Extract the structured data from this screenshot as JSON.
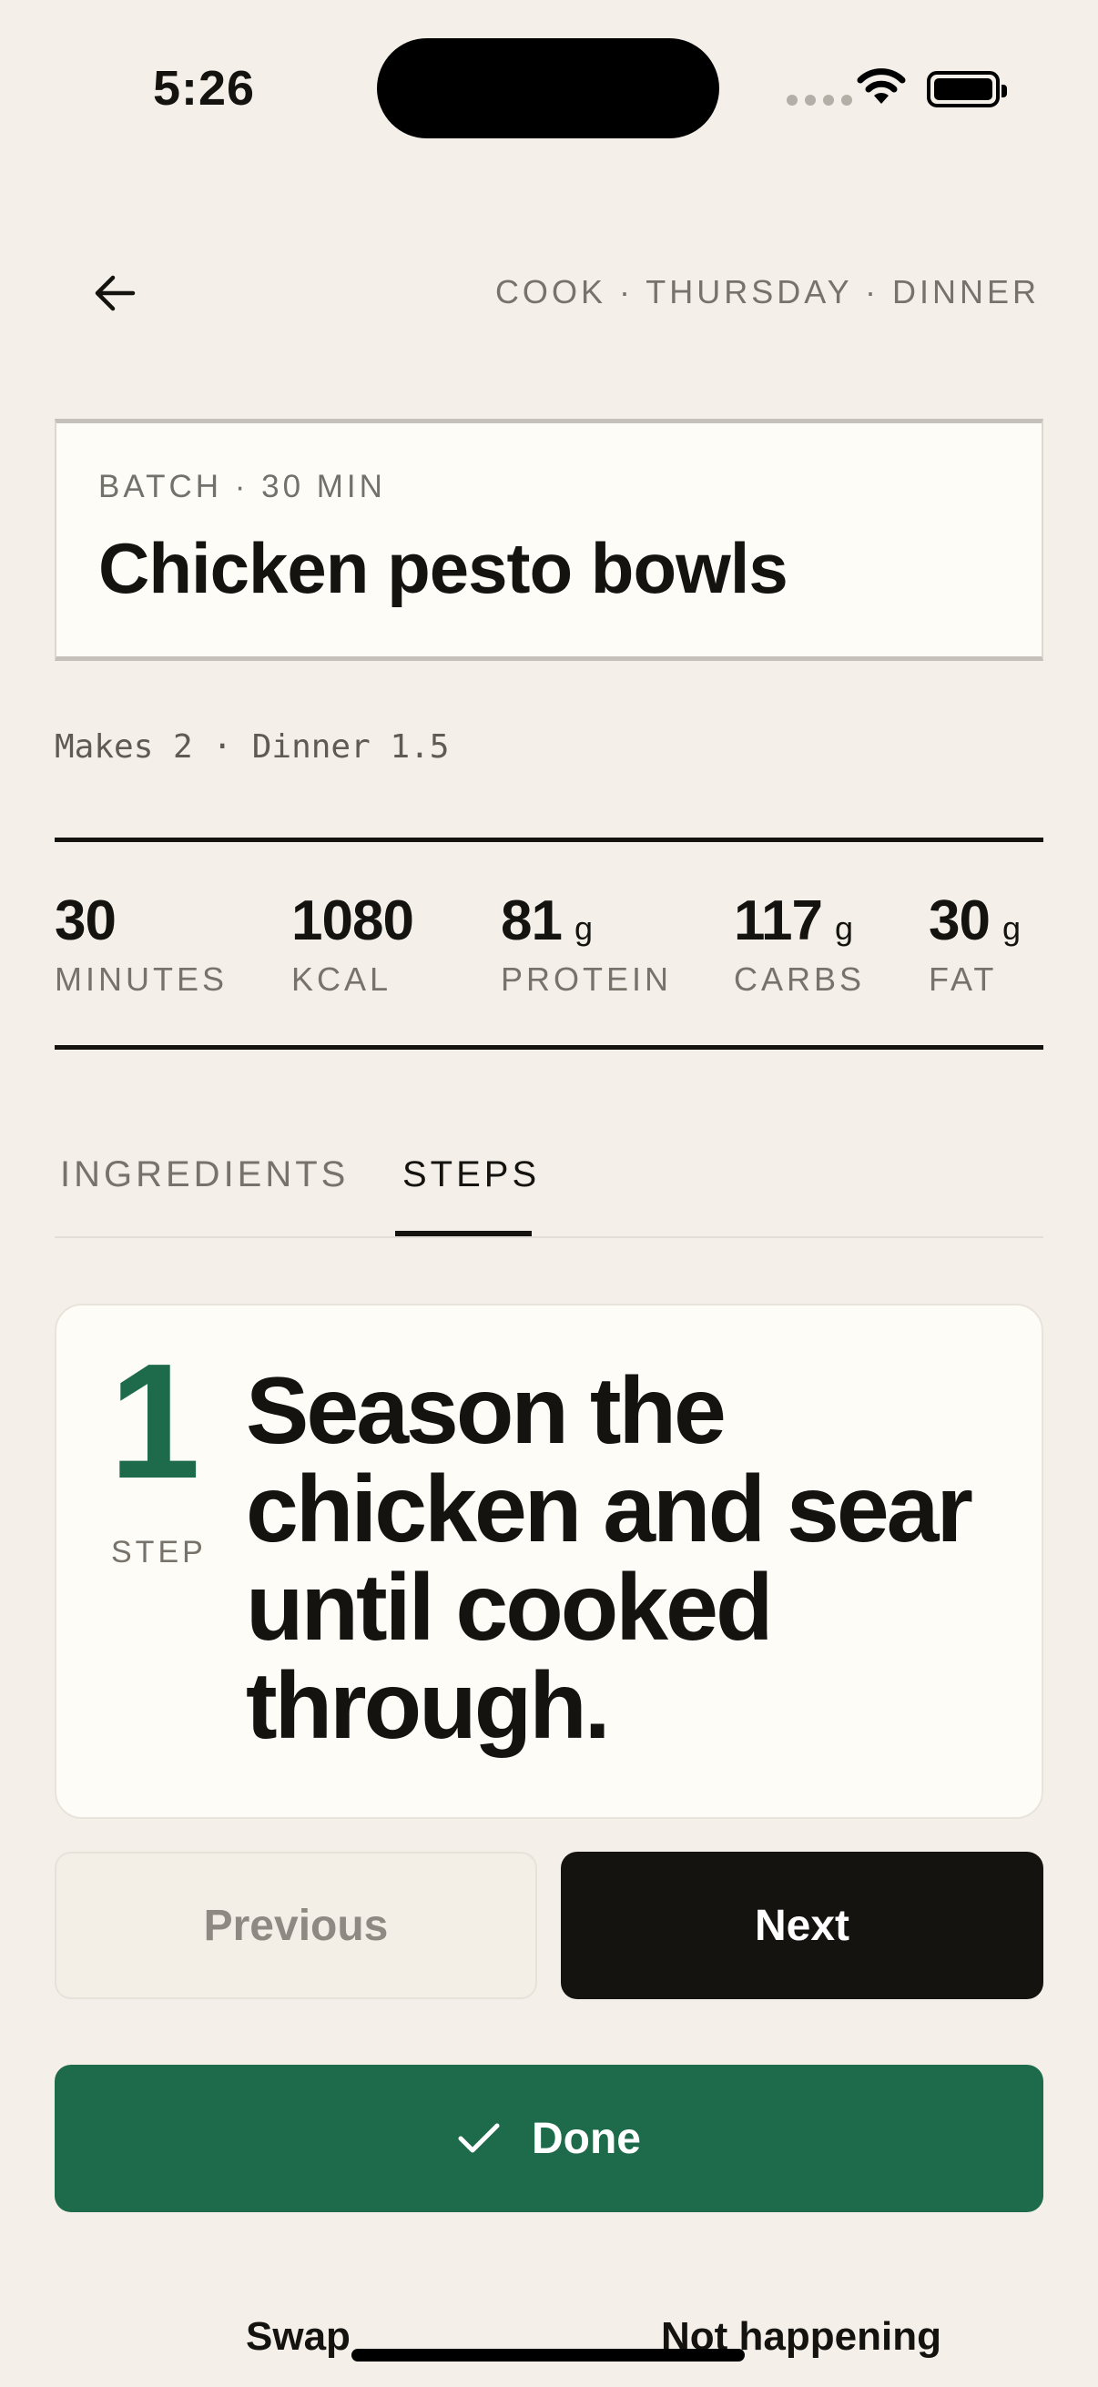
{
  "status_bar": {
    "time": "5:26"
  },
  "header": {
    "back_icon": "arrow-left-icon",
    "breadcrumb": "COOK · THURSDAY · DINNER"
  },
  "recipe": {
    "meta": "BATCH · 30 MIN",
    "title": "Chicken pesto bowls",
    "makes": "Makes 2 · Dinner 1.5"
  },
  "stats": [
    {
      "value": "30",
      "unit": "",
      "label": "MINUTES"
    },
    {
      "value": "1080",
      "unit": "",
      "label": "KCAL"
    },
    {
      "value": "81",
      "unit": "g",
      "label": "PROTEIN"
    },
    {
      "value": "117",
      "unit": "g",
      "label": "CARBS"
    },
    {
      "value": "30",
      "unit": "g",
      "label": "FAT"
    }
  ],
  "tabs": [
    {
      "label": "INGREDIENTS",
      "active": false
    },
    {
      "label": "STEPS",
      "active": true
    }
  ],
  "step": {
    "number": "1",
    "word": "STEP",
    "text": "Season the chicken and sear until cooked through."
  },
  "actions": {
    "previous_label": "Previous",
    "next_label": "Next",
    "done_label": "Done",
    "done_icon": "check-icon",
    "swap_label": "Swap",
    "not_happening_label": "Not happening"
  },
  "colors": {
    "background": "#f4f0e9",
    "accent_green": "#1e6b4c",
    "ink": "#141310",
    "muted": "#77726a"
  }
}
